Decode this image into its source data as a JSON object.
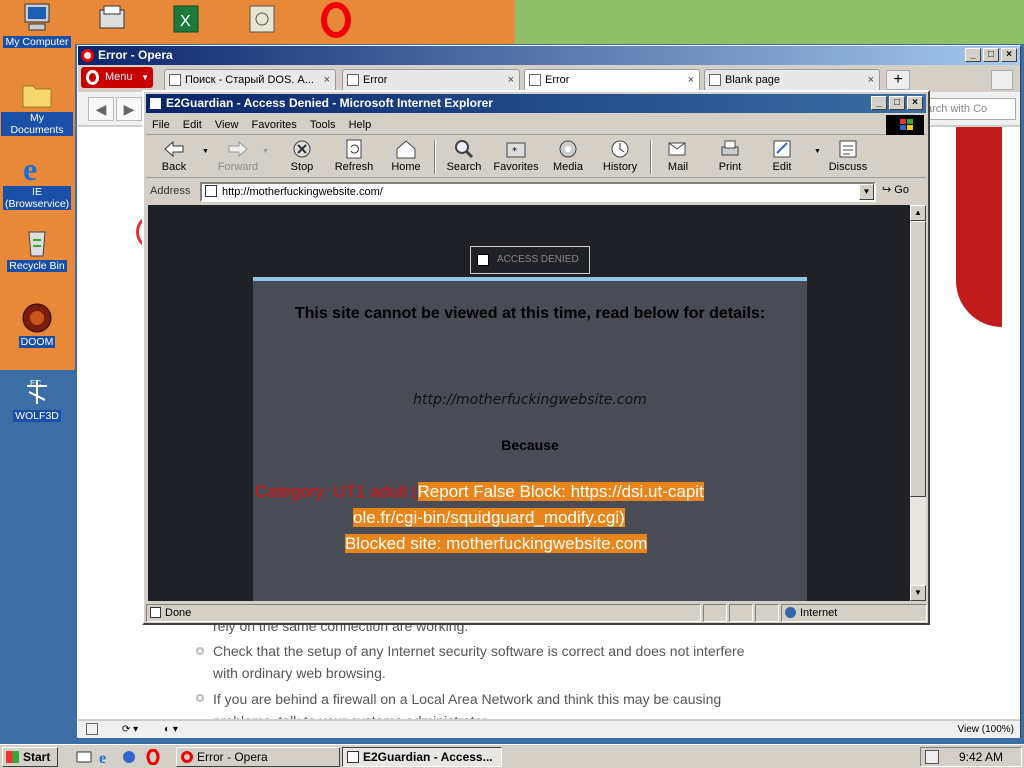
{
  "desktop": {
    "icons": [
      {
        "label": "My Computer"
      },
      {
        "label": "My Documents"
      },
      {
        "label": "IE (Browservice)"
      },
      {
        "label": "Recycle Bin"
      },
      {
        "label": "DOOM"
      },
      {
        "label": "WOLF3D"
      }
    ]
  },
  "opera": {
    "title": "Error - Opera",
    "menu_label": "Menu",
    "tabs": [
      {
        "label": "Поиск - Старый DOS. А...",
        "active": false
      },
      {
        "label": "Error",
        "active": false
      },
      {
        "label": "Error",
        "active": true
      },
      {
        "label": "Blank page",
        "active": false
      }
    ],
    "search_placeholder": "arch with Co",
    "bg_list": [
      "rely on the same connection are working.",
      "Check that the setup of any Internet security software is correct and does not interfere",
      "with ordinary web browsing.",
      "If you are behind a firewall on a Local Area Network and think this may be causing",
      "problems, talk to your systems administrator."
    ],
    "zoom_label": "View (100%)"
  },
  "ie": {
    "title": "E2Guardian - Access Denied - Microsoft Internet Explorer",
    "menu": [
      "File",
      "Edit",
      "View",
      "Favorites",
      "Tools",
      "Help"
    ],
    "toolbar": [
      "Back",
      "Forward",
      "Stop",
      "Refresh",
      "Home",
      "Search",
      "Favorites",
      "Media",
      "History",
      "Mail",
      "Print",
      "Edit",
      "Discuss"
    ],
    "address_label": "Address",
    "address_value": "http://motherfuckingwebsite.com/",
    "go_label": "Go",
    "status_text": "Done",
    "zone_text": "Internet"
  },
  "page": {
    "badge": "ACCESS DENIED",
    "heading": "This site cannot be viewed at this time, read below for details:",
    "url": "http://motherfuckingwebsite.com",
    "because": "Because",
    "category": "Category: UT1 adult (",
    "report_line1": "Report False Block: https://dsi.ut-capit",
    "report_line2": "ole.fr/cgi-bin/squidguard_modify.cgi)",
    "blocked": "Blocked site: motherfuckingwebsite.com"
  },
  "taskbar": {
    "start_label": "Start",
    "tasks": [
      {
        "label": "Error - Opera",
        "active": false
      },
      {
        "label": "E2Guardian - Access...",
        "active": true
      }
    ],
    "clock": "9:42 AM"
  },
  "colors": {
    "title_active": "#0a246a",
    "highlight": "#e8851a",
    "category_red": "#e01010",
    "panel_bg": "#4a4c55",
    "panel_border": "#8fc7e8"
  }
}
